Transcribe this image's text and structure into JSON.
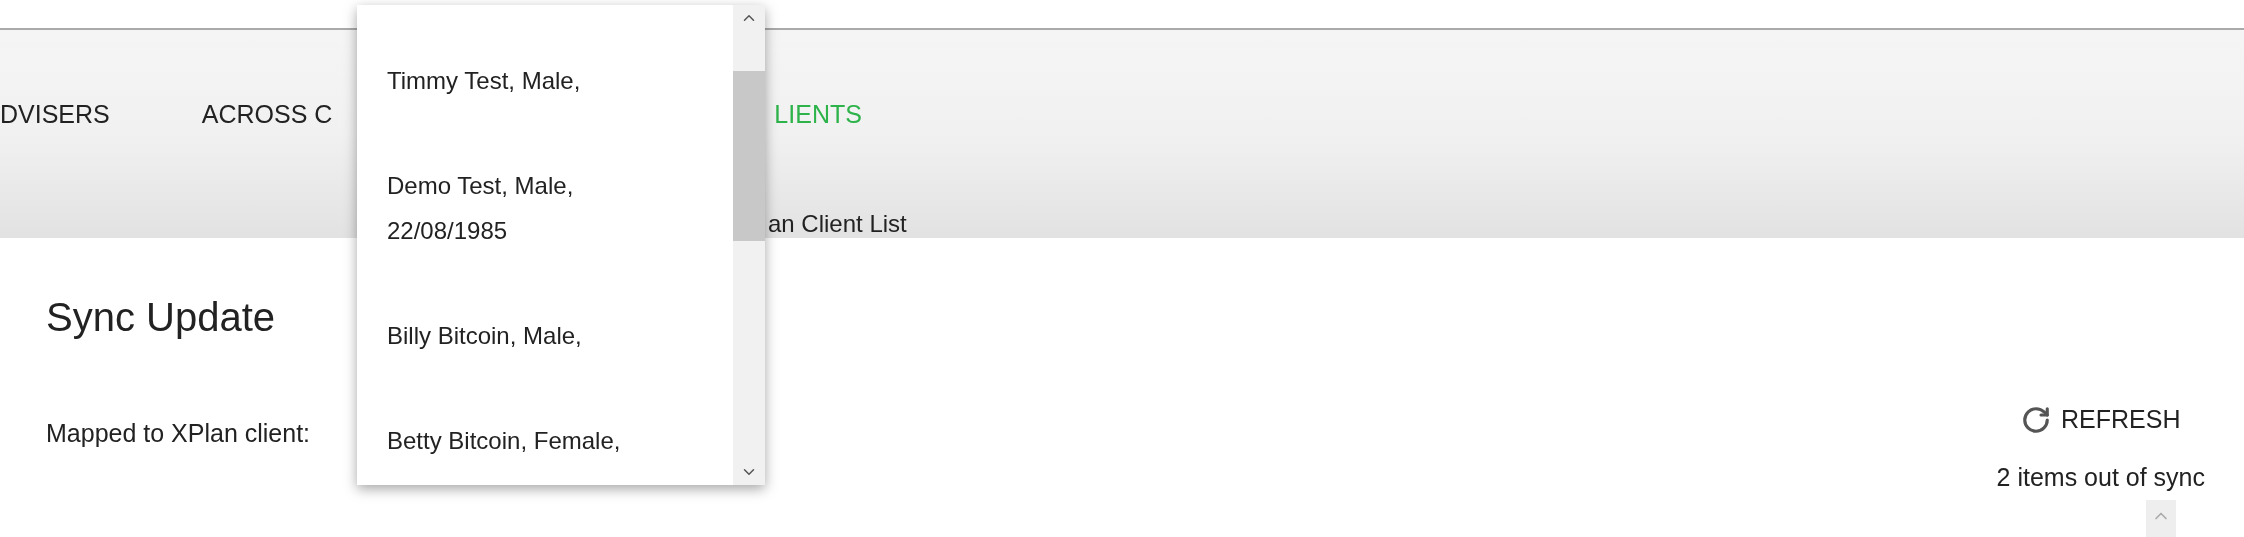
{
  "nav": {
    "tabs": [
      {
        "label": "DVISERS",
        "selected": false
      },
      {
        "label": "ACROSS C",
        "selected": false
      },
      {
        "label": "LIENTS",
        "selected": true
      }
    ],
    "subtitle": "an Client List"
  },
  "dropdown": {
    "options": [
      "Timmy Test, Male,",
      "Demo Test, Male, 22/08/1985",
      "Billy Bitcoin, Male,",
      "Betty Bitcoin, Female,"
    ]
  },
  "heading": "Sync Update",
  "field_label": "Mapped to XPlan client:",
  "refresh_button": "REFRESH",
  "sync_status": "2 items out of sync"
}
